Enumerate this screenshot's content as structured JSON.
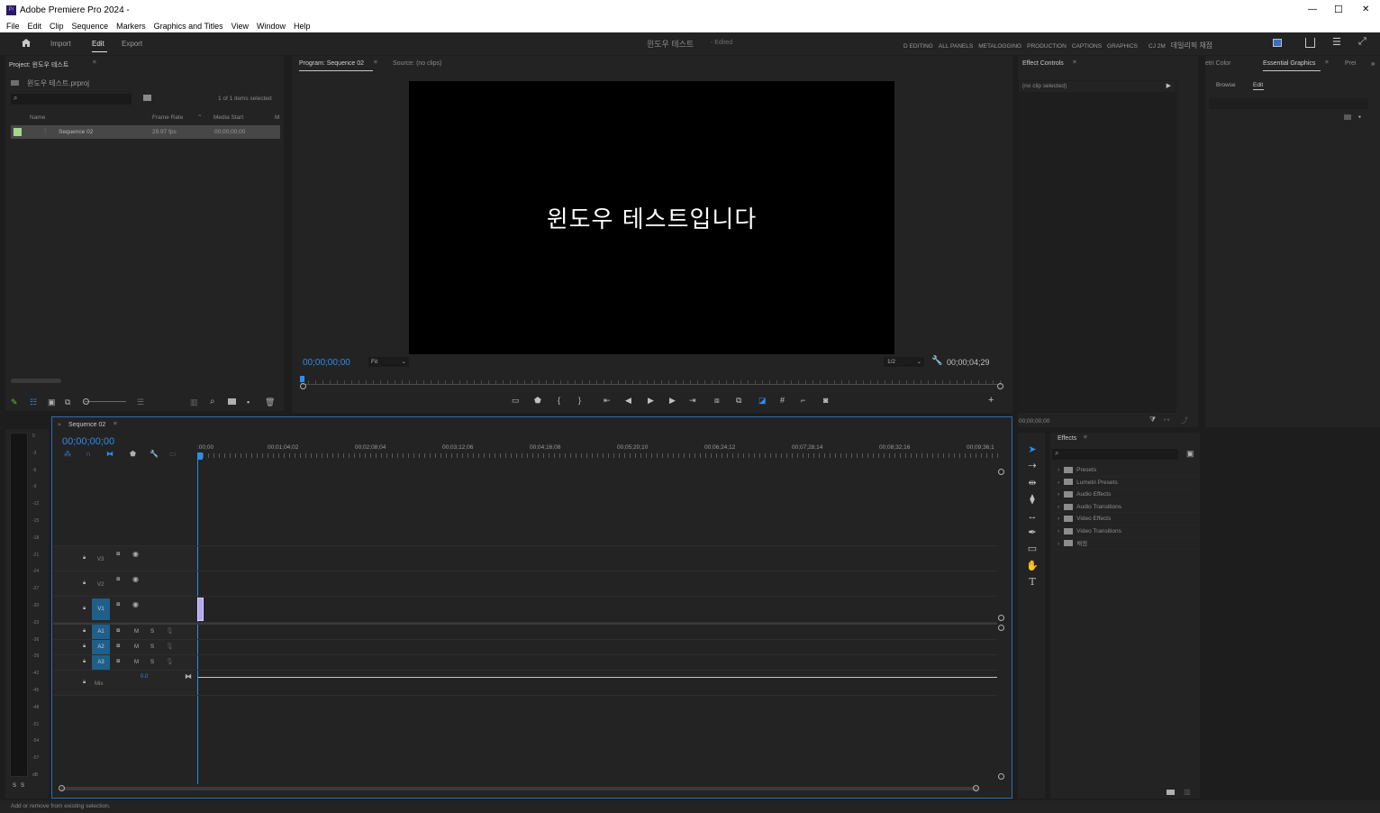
{
  "window": {
    "title": "Adobe Premiere Pro 2024 -",
    "app_icon": "Pr",
    "controls": [
      "—",
      "☐",
      "✕"
    ]
  },
  "menu": [
    "File",
    "Edit",
    "Clip",
    "Sequence",
    "Markers",
    "Graphics and Titles",
    "View",
    "Window",
    "Help"
  ],
  "top_tabs": {
    "import": "Import",
    "edit": "Edit",
    "export": "Export"
  },
  "doc_title": "윈도우 테스트",
  "doc_status": "- Edited",
  "workspaces": [
    "D EDITING",
    "ALL PANELS",
    "METALOGGING",
    "PRODUCTION",
    "CAPTIONS",
    "GRAPHICS",
    "CJ 2M",
    "데일리픽 채점"
  ],
  "project": {
    "title": "Project: 윈도우 테스트",
    "file": "윈도우 테스트.prproj",
    "selected": "1 of 1 items selected",
    "columns": [
      "Name",
      "Frame Rate",
      "Media Start",
      "M"
    ],
    "item": {
      "name": "Sequence 02",
      "fps": "29.97 fps",
      "start": "00;00;00;00"
    }
  },
  "program": {
    "tab": "Program: Sequence 02",
    "source_tab": "Source: (no clips)",
    "video_text": "윈도우 테스트입니다",
    "timecode": "00;00;00;00",
    "fit": "Fit",
    "res": "1/2",
    "duration": "00;00;04;29"
  },
  "effect_controls": {
    "title": "Effect Controls",
    "no_clip": "(no clip selected)",
    "timecode": "00;00;00;00"
  },
  "essential": {
    "tabs": [
      "etri Color",
      "Essential Graphics",
      "Prei"
    ],
    "subtabs": [
      "Browse",
      "Edit"
    ]
  },
  "effects": {
    "title": "Effects",
    "items": [
      "Presets",
      "Lumetri Presets",
      "Audio Effects",
      "Audio Transitions",
      "Video Effects",
      "Video Transitions",
      "채점"
    ]
  },
  "meter": {
    "labels": [
      "0",
      "-3",
      "-6",
      "-9",
      "-12",
      "-15",
      "-18",
      "-21",
      "-24",
      "-27",
      "-30",
      "-33",
      "-36",
      "-39",
      "-42",
      "-45",
      "-48",
      "-51",
      "-54",
      "-57",
      "dB"
    ],
    "solo": [
      "S",
      "S"
    ]
  },
  "timeline": {
    "tab": "Sequence 02",
    "timecode": "00;00;00;00",
    "ruler": [
      ":00;00",
      "00;01;04;02",
      "00;02;08;04",
      "00;03;12;06",
      "00;04;16;08",
      "00;05;20;10",
      "00;06;24;12",
      "00;07;28;14",
      "00;08;32;16",
      "00;09;36;1"
    ],
    "video_tracks": [
      "V3",
      "V2",
      "V1"
    ],
    "audio_tracks": [
      "A1",
      "A2",
      "A3"
    ],
    "mix": "Mix",
    "mix_val": "0.0",
    "ms": [
      "M",
      "S"
    ]
  },
  "status": "Add or remove from existing selection.",
  "colors": {
    "accent": "#2d8ceb",
    "clip": "#b3a7f0",
    "track_toggle": "#1f5f8a"
  }
}
